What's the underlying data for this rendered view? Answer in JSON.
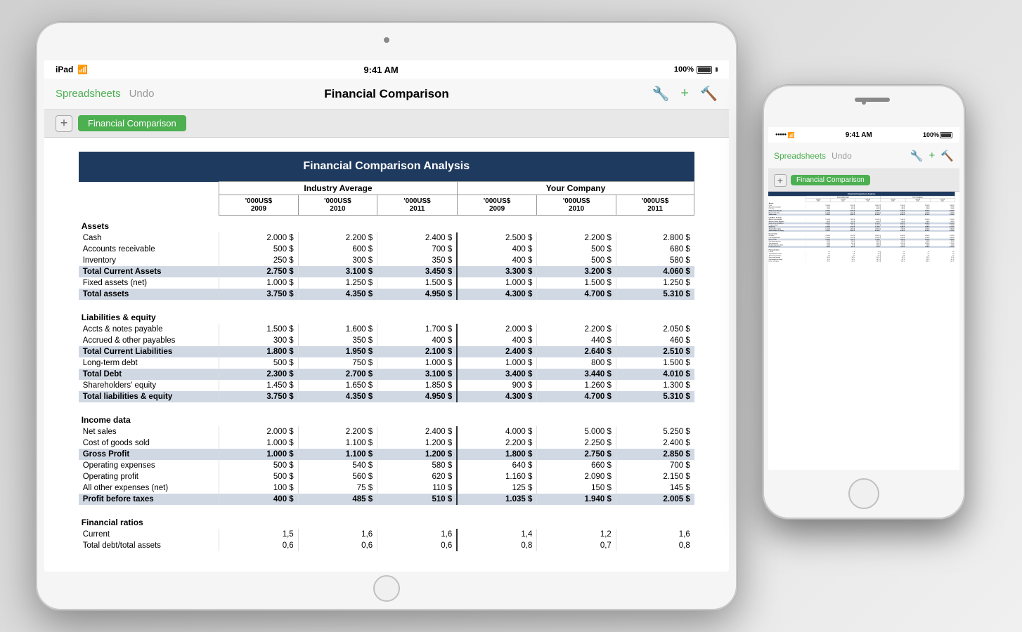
{
  "scene": {
    "background": "#e0e0e0"
  },
  "ipad": {
    "status_bar": {
      "left": "iPad",
      "wifi": "📶",
      "time": "9:41 AM",
      "battery": "100%"
    },
    "toolbar": {
      "back_label": "Spreadsheets",
      "undo_label": "Undo",
      "title": "Financial Comparison"
    },
    "tab": {
      "add_label": "+",
      "active_tab": "Financial Comparison"
    }
  },
  "iphone": {
    "status_bar": {
      "dots": "●●●●●",
      "wifi": "WiFi",
      "time": "9:41 AM",
      "battery": "100%"
    },
    "toolbar": {
      "back_label": "Spreadsheets",
      "undo_label": "Undo"
    },
    "tab": {
      "add_label": "+",
      "active_tab": "Financial Comparison"
    }
  },
  "spreadsheet": {
    "title": "Financial Comparison Analysis",
    "col_groups": {
      "industry": "Industry Average",
      "company": "Your Company"
    },
    "col_years": [
      "'000US$ 2009",
      "'000US$ 2010",
      "'000US$ 2011"
    ],
    "sections": [
      {
        "name": "Assets",
        "rows": [
          {
            "label": "Cash",
            "ind": [
              "2.000 $",
              "2.200 $",
              "2.400 $"
            ],
            "comp": [
              "2.500 $",
              "2.200 $",
              "2.800 $"
            ]
          },
          {
            "label": "Accounts receivable",
            "ind": [
              "500 $",
              "600 $",
              "700 $"
            ],
            "comp": [
              "400 $",
              "500 $",
              "680 $"
            ]
          },
          {
            "label": "Inventory",
            "ind": [
              "250 $",
              "300 $",
              "350 $"
            ],
            "comp": [
              "400 $",
              "500 $",
              "580 $"
            ]
          },
          {
            "label": "Total Current Assets",
            "bold": true,
            "ind": [
              "2.750 $",
              "3.100 $",
              "3.450 $"
            ],
            "comp": [
              "3.300 $",
              "3.200 $",
              "4.060 $"
            ]
          },
          {
            "label": "Fixed assets (net)",
            "ind": [
              "1.000 $",
              "1.250 $",
              "1.500 $"
            ],
            "comp": [
              "1.000 $",
              "1.500 $",
              "1.250 $"
            ]
          },
          {
            "label": "Total assets",
            "bold": true,
            "ind": [
              "3.750 $",
              "4.350 $",
              "4.950 $"
            ],
            "comp": [
              "4.300 $",
              "4.700 $",
              "5.310 $"
            ]
          }
        ]
      },
      {
        "name": "Liabilities & equity",
        "rows": [
          {
            "label": "Accts & notes payable",
            "ind": [
              "1.500 $",
              "1.600 $",
              "1.700 $"
            ],
            "comp": [
              "2.000 $",
              "2.200 $",
              "2.050 $"
            ]
          },
          {
            "label": "Accrued & other payables",
            "ind": [
              "300 $",
              "350 $",
              "400 $"
            ],
            "comp": [
              "400 $",
              "440 $",
              "460 $"
            ]
          },
          {
            "label": "Total Current Liabilities",
            "bold": true,
            "ind": [
              "1.800 $",
              "1.950 $",
              "2.100 $"
            ],
            "comp": [
              "2.400 $",
              "2.640 $",
              "2.510 $"
            ]
          },
          {
            "label": "Long-term debt",
            "ind": [
              "500 $",
              "750 $",
              "1.000 $"
            ],
            "comp": [
              "1.000 $",
              "800 $",
              "1.500 $"
            ]
          },
          {
            "label": "Total Debt",
            "bold": true,
            "ind": [
              "2.300 $",
              "2.700 $",
              "3.100 $"
            ],
            "comp": [
              "3.400 $",
              "3.440 $",
              "4.010 $"
            ]
          },
          {
            "label": "Shareholders' equity",
            "ind": [
              "1.450 $",
              "1.650 $",
              "1.850 $"
            ],
            "comp": [
              "900 $",
              "1.260 $",
              "1.300 $"
            ]
          },
          {
            "label": "Total liabilities & equity",
            "bold": true,
            "ind": [
              "3.750 $",
              "4.350 $",
              "4.950 $"
            ],
            "comp": [
              "4.300 $",
              "4.700 $",
              "5.310 $"
            ]
          }
        ]
      },
      {
        "name": "Income data",
        "rows": [
          {
            "label": "Net sales",
            "ind": [
              "2.000 $",
              "2.200 $",
              "2.400 $"
            ],
            "comp": [
              "4.000 $",
              "5.000 $",
              "5.250 $"
            ]
          },
          {
            "label": "Cost of goods sold",
            "ind": [
              "1.000 $",
              "1.100 $",
              "1.200 $"
            ],
            "comp": [
              "2.200 $",
              "2.250 $",
              "2.400 $"
            ]
          },
          {
            "label": "Gross Profit",
            "bold": true,
            "ind": [
              "1.000 $",
              "1.100 $",
              "1.200 $"
            ],
            "comp": [
              "1.800 $",
              "2.750 $",
              "2.850 $"
            ]
          },
          {
            "label": "Operating expenses",
            "ind": [
              "500 $",
              "540 $",
              "580 $"
            ],
            "comp": [
              "640 $",
              "660 $",
              "700 $"
            ]
          },
          {
            "label": "Operating profit",
            "ind": [
              "500 $",
              "560 $",
              "620 $"
            ],
            "comp": [
              "1.160 $",
              "2.090 $",
              "2.150 $"
            ]
          },
          {
            "label": "All other expenses (net)",
            "ind": [
              "100 $",
              "75 $",
              "110 $"
            ],
            "comp": [
              "125 $",
              "150 $",
              "145 $"
            ]
          },
          {
            "label": "Profit before taxes",
            "bold": true,
            "ind": [
              "400 $",
              "485 $",
              "510 $"
            ],
            "comp": [
              "1.035 $",
              "1.940 $",
              "2.005 $"
            ]
          }
        ]
      },
      {
        "name": "Financial ratios",
        "rows": [
          {
            "label": "Current",
            "ind": [
              "1,5",
              "1,6",
              "1,6"
            ],
            "comp": [
              "1,4",
              "1,2",
              "1,6"
            ]
          },
          {
            "label": "Total debt/total assets",
            "ind": [
              "0,6",
              "0,6",
              "0,6"
            ],
            "comp": [
              "0,8",
              "0,7",
              "0,8"
            ]
          }
        ]
      }
    ]
  }
}
